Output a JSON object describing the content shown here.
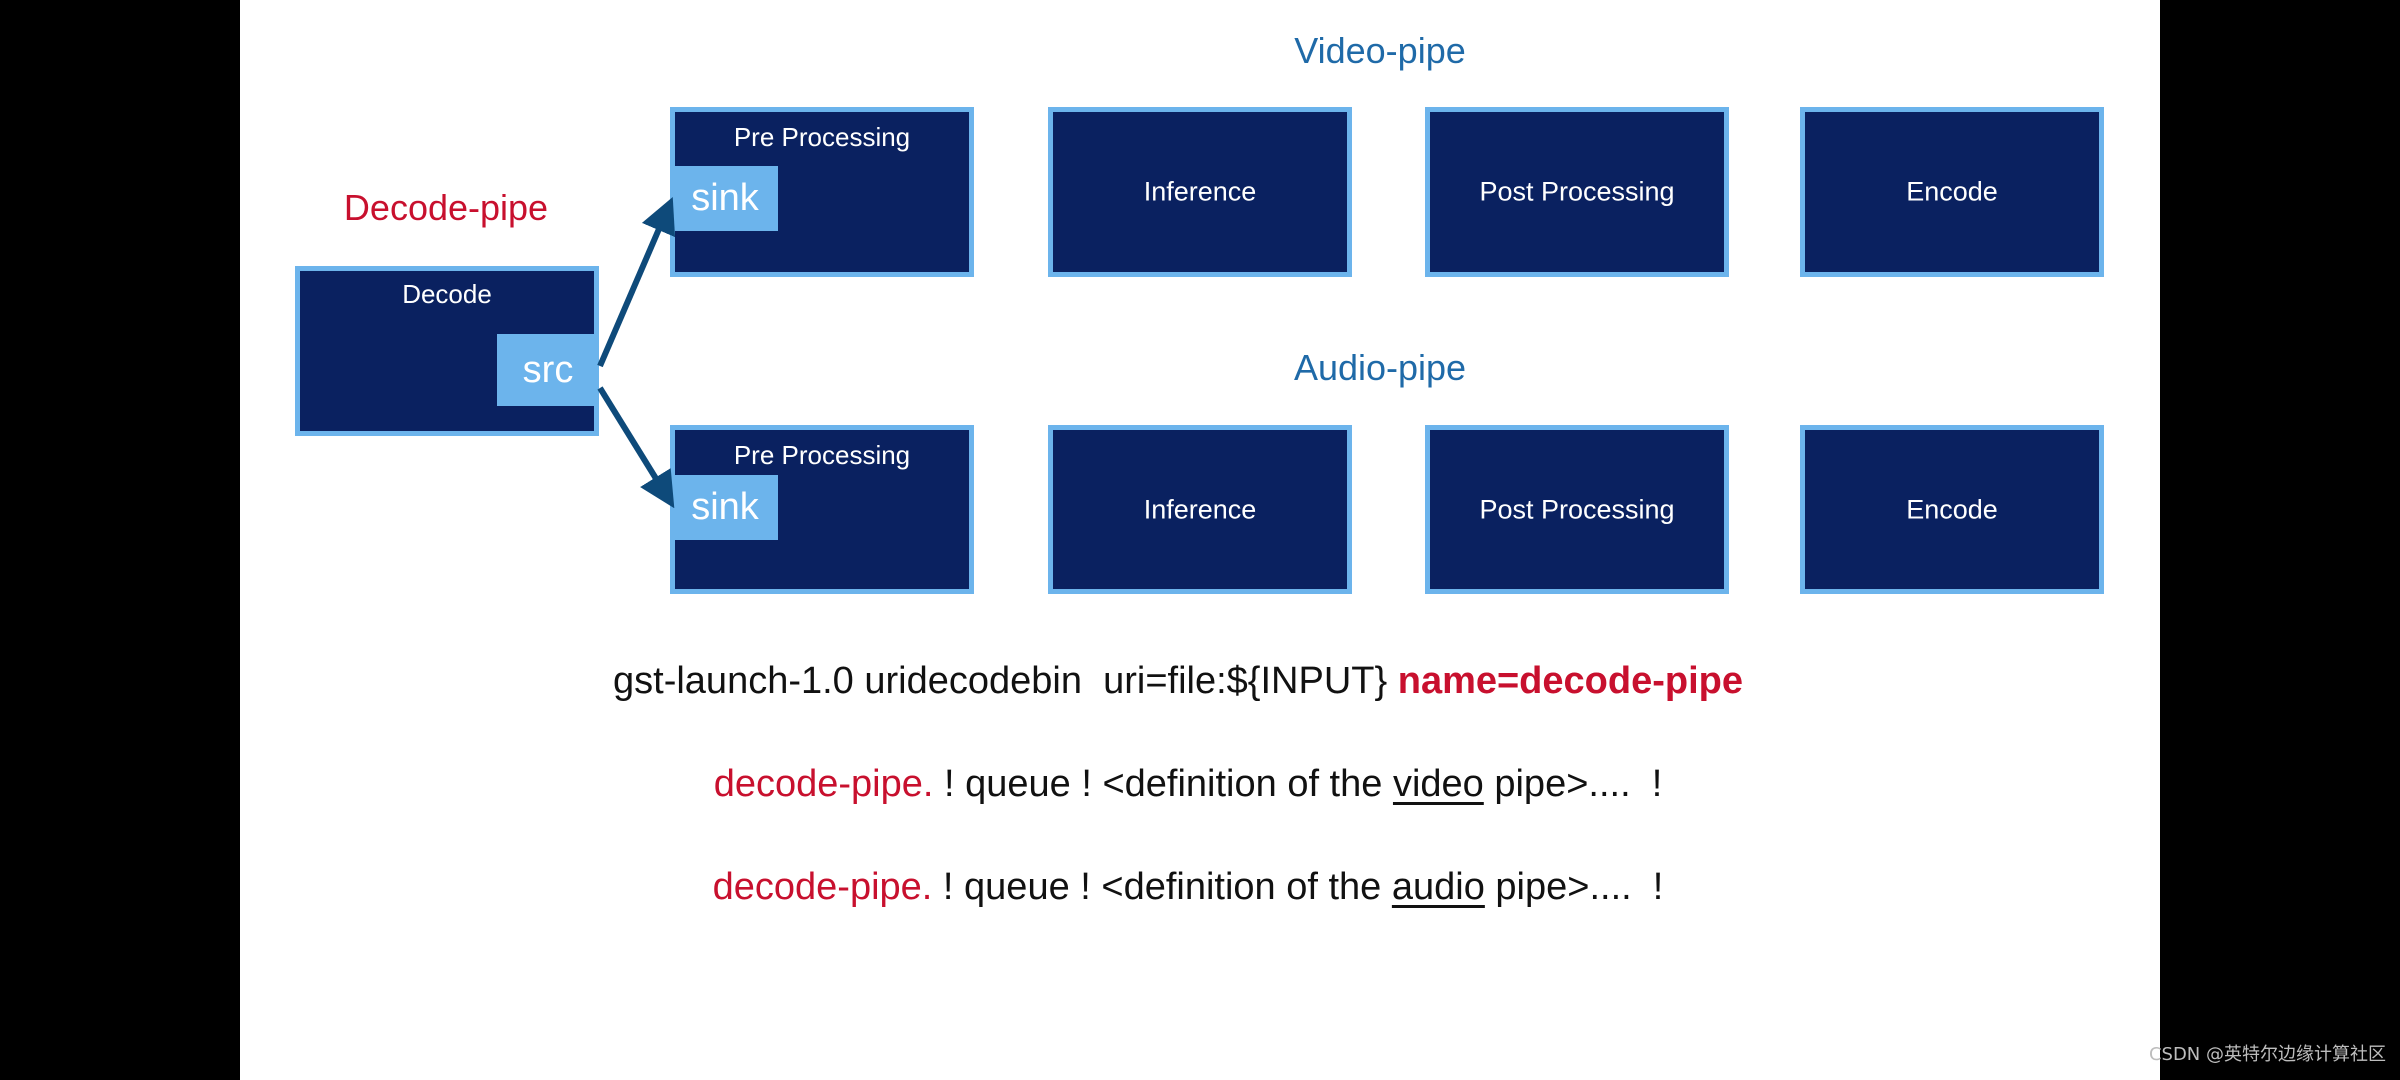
{
  "diagram": {
    "decode_pipe_label": "Decode-pipe",
    "video_pipe_label": "Video-pipe",
    "audio_pipe_label": "Audio-pipe",
    "decode_element": {
      "title": "Decode",
      "src_pad": "src"
    },
    "video_pipe": {
      "elements": [
        {
          "label": "Pre Processing",
          "sink_pad": "sink"
        },
        {
          "label": "Inference"
        },
        {
          "label": "Post Processing"
        },
        {
          "label": "Encode"
        }
      ]
    },
    "audio_pipe": {
      "elements": [
        {
          "label": "Pre Processing",
          "sink_pad": "sink"
        },
        {
          "label": "Inference"
        },
        {
          "label": "Post Processing"
        },
        {
          "label": "Encode"
        }
      ]
    },
    "edges": [
      {
        "from": "Decode.src",
        "to": "Video-pipe.Pre Processing.sink"
      },
      {
        "from": "Decode.src",
        "to": "Audio-pipe.Pre Processing.sink"
      }
    ],
    "colors": {
      "element_fill": "#0a2160",
      "element_border": "#6cb4ec",
      "pad_fill": "#6cb4ec",
      "arrow": "#0e4a7a",
      "pipe_heading": "#1f6aa8",
      "highlight_red": "#c8102e"
    }
  },
  "command": {
    "line1": {
      "plain": "gst-launch-1.0 uridecodebin  uri=file:${INPUT} ",
      "highlight": "name=decode-pipe"
    },
    "line2": {
      "ref": "decode-pipe.",
      "middle": " ! queue ! <definition of the ",
      "underlined": "video",
      "tail": " pipe>....  !"
    },
    "line3": {
      "ref": "decode-pipe.",
      "middle": " ! queue ! <definition of the ",
      "underlined": "audio",
      "tail": " pipe>....  !"
    }
  },
  "watermark": "CSDN @英特尔边缘计算社区"
}
